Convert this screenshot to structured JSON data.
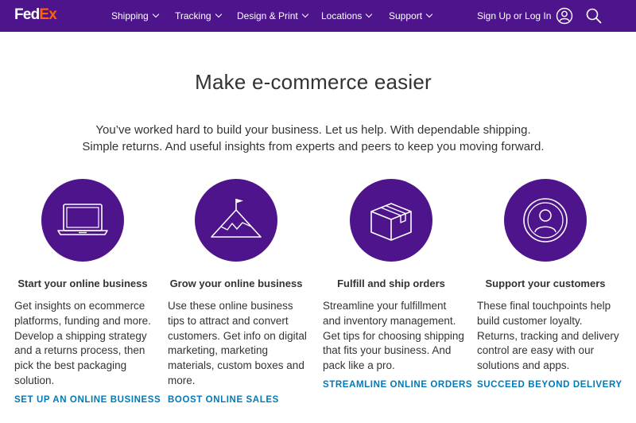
{
  "brand": {
    "logo_fed": "Fed",
    "logo_ex": "Ex",
    "primary": "#4d148c",
    "accent": "#ff6200",
    "link": "#007ab7"
  },
  "nav": {
    "items": [
      {
        "label": "Shipping"
      },
      {
        "label": "Tracking"
      },
      {
        "label": "Design & Print"
      },
      {
        "label": "Locations"
      },
      {
        "label": "Support"
      }
    ],
    "signin_label": "Sign Up or Log In",
    "user_icon": "user-circle-icon",
    "search_icon": "search-icon"
  },
  "hero": {
    "title": "Make e-commerce easier",
    "subtitle_line1": "You’ve worked hard to build your business. Let us help. With dependable shipping.",
    "subtitle_line2": "Simple returns. And useful insights from experts and peers to keep you moving forward."
  },
  "features": [
    {
      "icon": "laptop-icon",
      "title": "Start your online business",
      "description": "Get insights on ecommerce platforms, funding and more. Develop a shipping strategy and a returns process, then pick the best packaging solution.",
      "link": "SET UP AN ONLINE BUSINESS"
    },
    {
      "icon": "mountain-flag-icon",
      "title": "Grow your online business",
      "description": "Use these online business tips to attract and convert customers. Get info on digital marketing, marketing materials, custom boxes and more.",
      "link": "BOOST ONLINE SALES"
    },
    {
      "icon": "box-icon",
      "title": "Fulfill and ship orders",
      "description": "Streamline your fulfillment and inventory management. Get tips for choosing shipping that fits your business. And pack like a pro.",
      "link": "STREAMLINE ONLINE ORDERS"
    },
    {
      "icon": "customer-icon",
      "title": "Support your customers",
      "description": "These final touchpoints help build customer loyalty. Returns, tracking and delivery control are easy with our solutions and apps.",
      "link": "SUCCEED BEYOND DELIVERY"
    }
  ]
}
